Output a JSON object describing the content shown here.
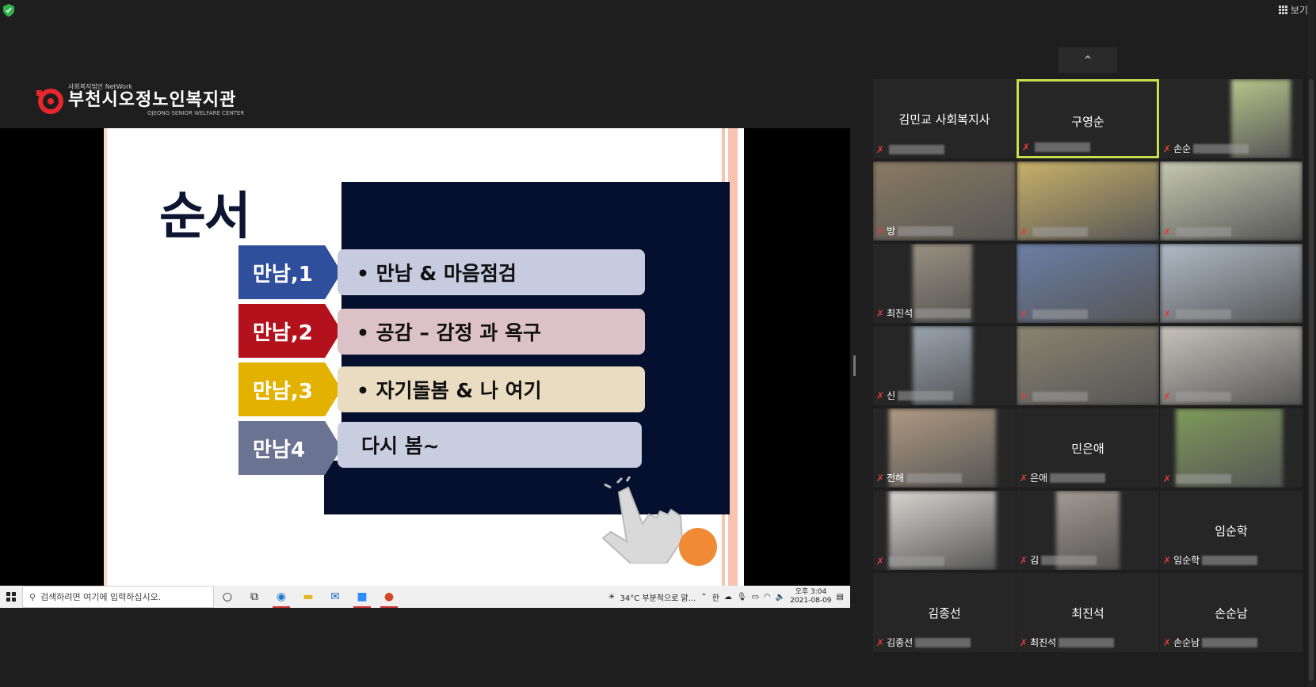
{
  "toolbar": {
    "view_label": "보기"
  },
  "logo": {
    "sub": "사회복지법인 NetWork",
    "main": "부천시오정노인복지관",
    "eng": "OJEONG SENIOR WELFARE CENTER"
  },
  "slide": {
    "title": "순서",
    "steps": [
      {
        "label": "만남,1",
        "text": "• 만남 & 마음점검"
      },
      {
        "label": "만남,2",
        "text": "• 공감 – 감정 과 욕구"
      },
      {
        "label": "만남,3",
        "text": "• 자기돌봄 & 나 여기"
      },
      {
        "label": "만남4",
        "text": "다시 봄~"
      }
    ]
  },
  "taskbar": {
    "search_placeholder": "검색하려면 여기에 입력하십시오.",
    "weather": "34°C  부분적으로 맑...",
    "ime": "한",
    "time": "오후 3:04",
    "date": "2021-08-09"
  },
  "gallery": {
    "tiles": [
      {
        "center": "김민교 사회복지사",
        "label": ""
      },
      {
        "center": "구영순",
        "label": ""
      },
      {
        "center": "",
        "label": "손순"
      },
      {
        "center": "",
        "label": "방"
      },
      {
        "center": "",
        "label": ""
      },
      {
        "center": "",
        "label": ""
      },
      {
        "center": "",
        "label": "최진석"
      },
      {
        "center": "",
        "label": ""
      },
      {
        "center": "",
        "label": ""
      },
      {
        "center": "",
        "label": "신"
      },
      {
        "center": "",
        "label": ""
      },
      {
        "center": "",
        "label": ""
      },
      {
        "center": "",
        "label": "전해"
      },
      {
        "center": "민은애",
        "label": "은애"
      },
      {
        "center": "",
        "label": ""
      },
      {
        "center": "",
        "label": ""
      },
      {
        "center": "",
        "label": "김"
      },
      {
        "center": "임순학",
        "label": "임순학"
      },
      {
        "center": "김종선",
        "label": "김종선"
      },
      {
        "center": "최진석",
        "label": "최진석"
      },
      {
        "center": "손순남",
        "label": "손순남"
      }
    ]
  },
  "colors": {
    "active_speaker": "#c5e04a",
    "slide_navy": "#050f2e",
    "step_blue": "#2f4e9c",
    "step_red": "#b3121c",
    "step_gold": "#e3b100",
    "step_slate": "#6a7391"
  }
}
